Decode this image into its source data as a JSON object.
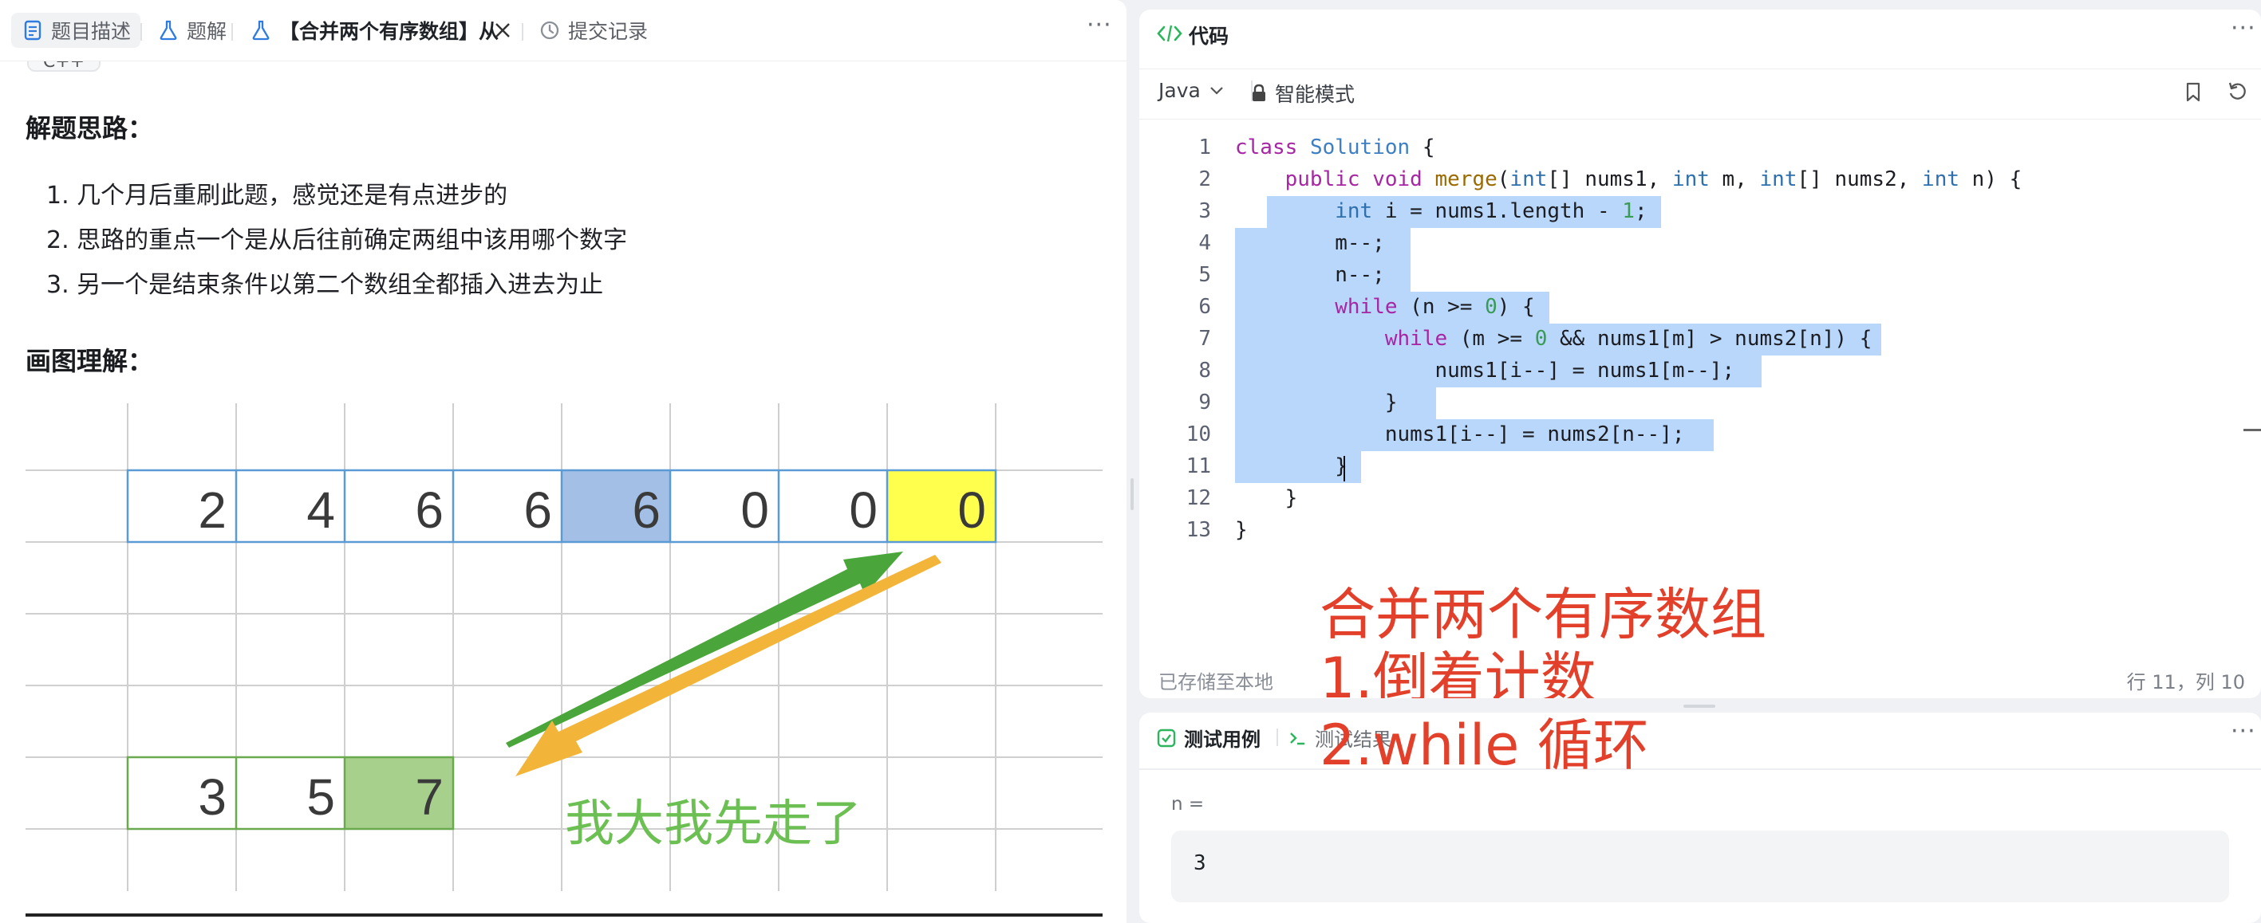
{
  "left_tabs": {
    "description": "题目描述",
    "solution": "题解",
    "article": "【合并两个有序数组】从",
    "submissions": "提交记录"
  },
  "article": {
    "lang_tag": "C++",
    "heading1": "解题思路：",
    "points": [
      "1. 几个月后重刷此题，感觉还是有点进步的",
      "2. 思路的重点一个是从后往前确定两组中该用哪个数字",
      "3. 另一个是结束条件以第二个数组全都插入进去为止"
    ],
    "heading2": "画图理解："
  },
  "diagram": {
    "row1": [
      "2",
      "4",
      "6",
      "6",
      "6",
      "0",
      "0",
      "0"
    ],
    "row2": [
      "3",
      "5",
      "7"
    ],
    "caption": "我大我先走了",
    "colors": {
      "cell_border": "#5b9bd5",
      "highlight_blue": "#a4bfe6",
      "highlight_yellow": "#ffff4d",
      "highlight_green": "#a8d08d",
      "arrow_green": "#4aa63a",
      "arrow_orange": "#f2b53a"
    }
  },
  "code_panel": {
    "title": "代码",
    "language": "Java",
    "mode": "智能模式",
    "status_left": "已存储至本地",
    "status_right": "行 11，列 10"
  },
  "annotation": {
    "line1": "合并两个有序数组",
    "line2": "1.倒着计数",
    "line3": "2.while 循环"
  },
  "test_panel": {
    "tab_cases": "测试用例",
    "tab_results": "测试结果",
    "field_label": "n =",
    "field_value": "3"
  },
  "colors": {
    "selection": "#b9d6fb",
    "annotation_red": "#e2402a",
    "accent_green": "#2db55d"
  }
}
